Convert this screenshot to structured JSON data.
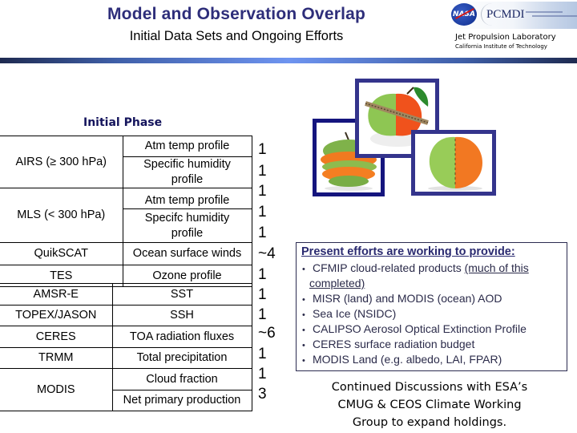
{
  "header": {
    "title": "Model and Observation Overlap",
    "subtitle": "Initial Data Sets and Ongoing Efforts",
    "logos": {
      "nasa": "NASA",
      "pcmdi": "PCMDI",
      "institution": "Jet Propulsion Laboratory",
      "institution_sub": "California Institute of Technology"
    }
  },
  "section_heading": "Initial Phase",
  "datasets": [
    {
      "instrument": "AIRS (≥  300 hPa)",
      "products": [
        {
          "name": "Atm temp profile",
          "count": "1"
        },
        {
          "name": "Specific humidity profile",
          "count": "1"
        }
      ]
    },
    {
      "instrument": "MLS (< 300 hPa)",
      "products": [
        {
          "name": "Atm temp profile",
          "count": "1"
        },
        {
          "name": "Specifc humidity profile",
          "count": "1"
        }
      ]
    },
    {
      "instrument": "QuikSCAT",
      "products": [
        {
          "name": "Ocean surface winds",
          "count": "~4"
        }
      ]
    },
    {
      "instrument": "TES",
      "products": [
        {
          "name": "Ozone profile",
          "count": "1"
        }
      ]
    },
    {
      "instrument": "AMSR-E",
      "products": [
        {
          "name": "SST",
          "count": "1"
        }
      ]
    },
    {
      "instrument": "TOPEX/JASON",
      "products": [
        {
          "name": "SSH",
          "count": "1"
        }
      ]
    },
    {
      "instrument": "CERES",
      "products": [
        {
          "name": "TOA radiation fluxes",
          "count": "~6"
        }
      ]
    },
    {
      "instrument": "TRMM",
      "products": [
        {
          "name": "Total precipitation",
          "count": "1"
        }
      ]
    },
    {
      "instrument": "MODIS",
      "products": [
        {
          "name": "Cloud fraction",
          "count": "1"
        },
        {
          "name": "Net primary production",
          "count": "3"
        }
      ]
    }
  ],
  "count_column": [
    "1",
    "1",
    "1",
    "1",
    "1",
    "~4",
    "1",
    "1",
    "1",
    "~6",
    "1",
    "1",
    "3"
  ],
  "images": [
    {
      "subject": "apple-orange striped slices"
    },
    {
      "subject": "apple-orange belted halves"
    },
    {
      "subject": "apple-orange stitched halves"
    }
  ],
  "efforts": {
    "heading": "Present efforts are working to provide:",
    "items": [
      {
        "text": "CFMIP cloud-related products ",
        "note": "(much of this",
        "note2": "completed)"
      },
      {
        "text": "MISR (land) and MODIS (ocean) AOD"
      },
      {
        "text": "Sea Ice (NSIDC)"
      },
      {
        "text": "CALIPSO Aerosol Optical Extinction Profile"
      },
      {
        "text": "CERES surface radiation budget"
      },
      {
        "text": "MODIS Land (e.g. albedo, LAI, FPAR)"
      }
    ],
    "bullet": "•"
  },
  "discussion": {
    "line1": "Continued Discussions with ESA’s",
    "line2": "CMUG & CEOS Climate Working",
    "line3": "Group to expand holdings."
  },
  "colors": {
    "title": "#2e2e7a",
    "heading": "#14145c",
    "frame_dark": "#15157e",
    "frame": "#34348c",
    "bar_center": "#6e94f0"
  }
}
